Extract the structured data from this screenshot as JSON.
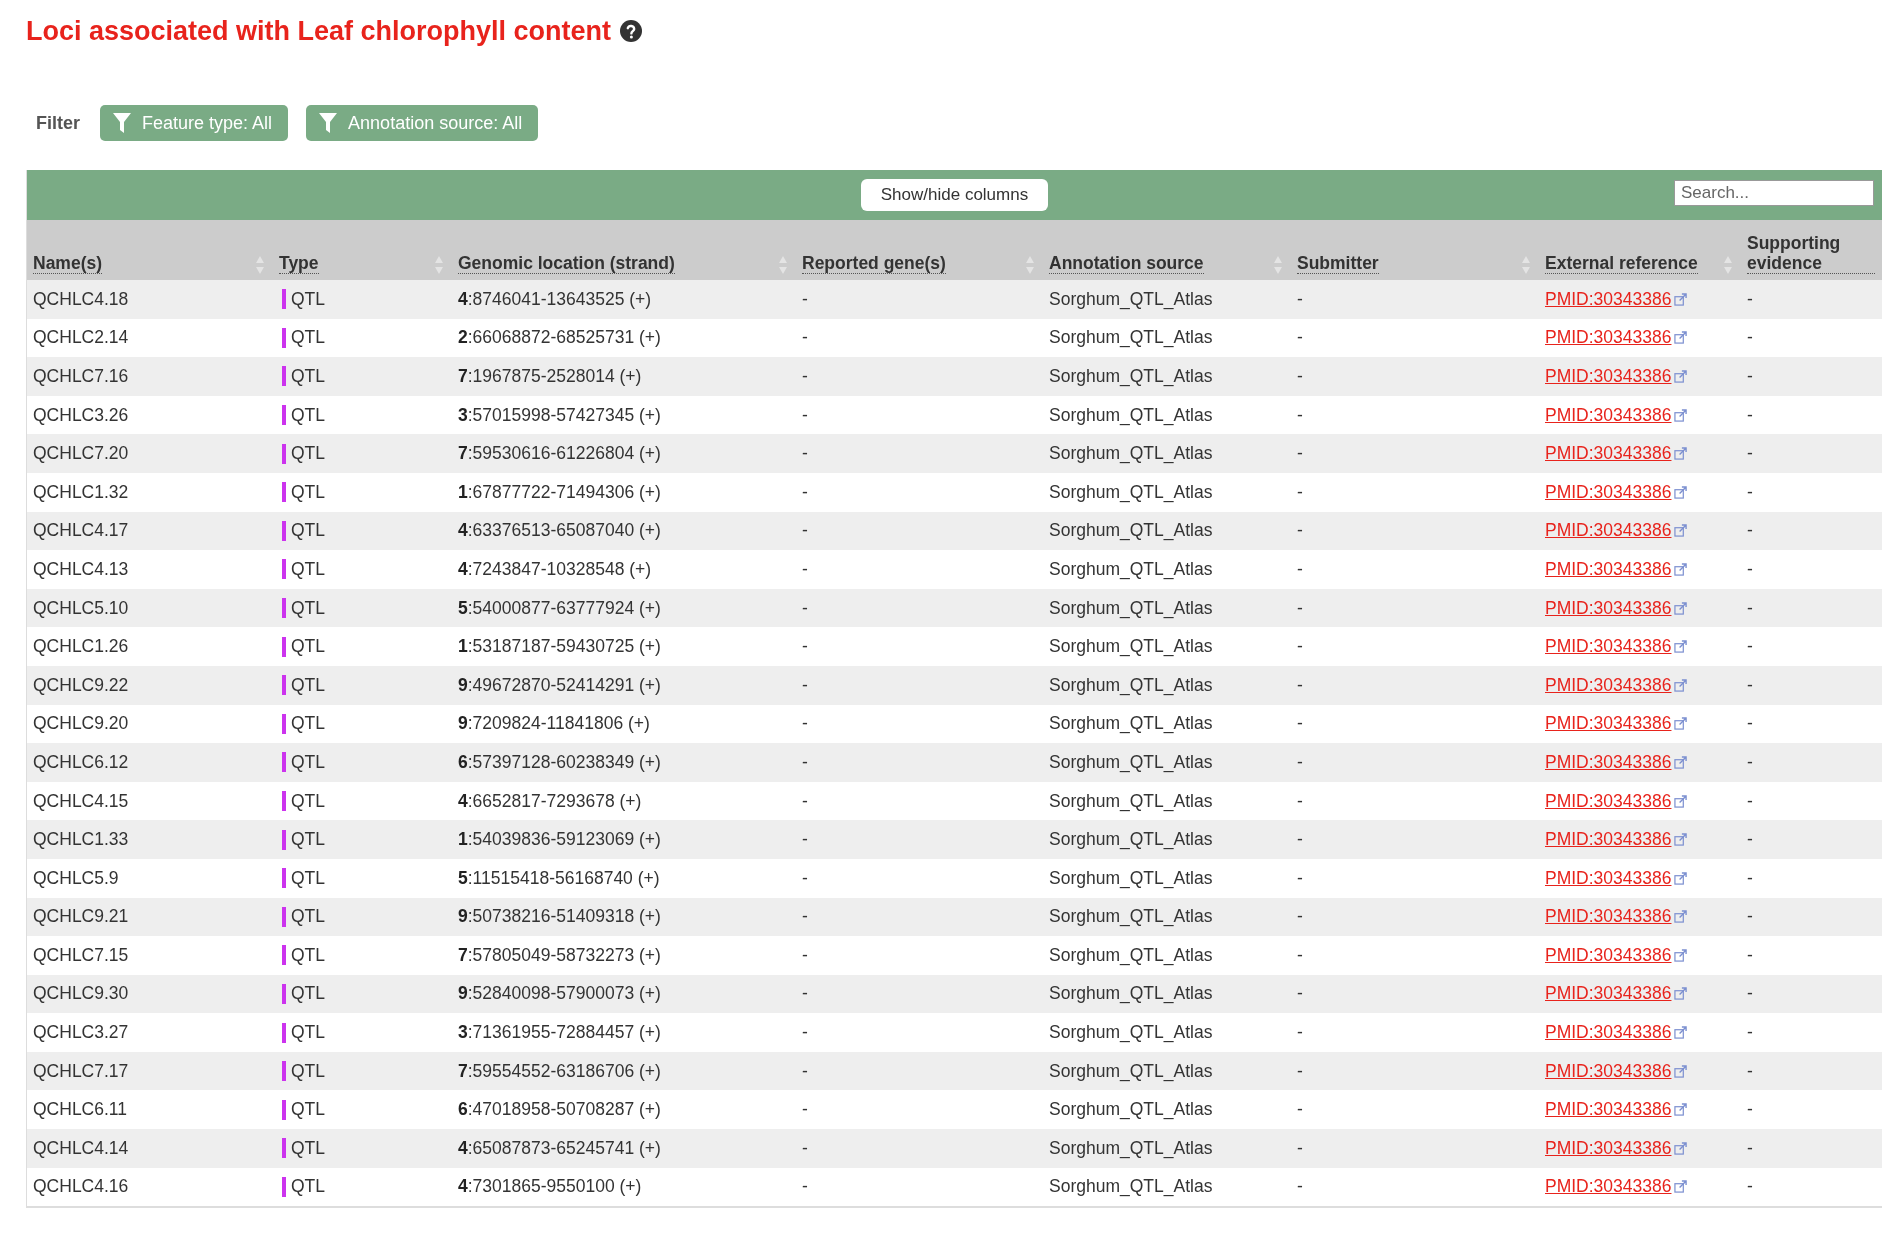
{
  "title": "Loci associated with Leaf chlorophyll content",
  "filter": {
    "label": "Filter",
    "buttons": [
      "Feature type: All",
      "Annotation source: All"
    ]
  },
  "toolbar": {
    "show_hide_button": "Show/hide columns",
    "search": {
      "placeholder": "Search..."
    }
  },
  "table": {
    "columns": [
      {
        "label": "Name(s)",
        "sortable": true
      },
      {
        "label": "Type",
        "sortable": true
      },
      {
        "label": "Genomic location (strand)",
        "sortable": true
      },
      {
        "label": "Reported gene(s)",
        "sortable": true
      },
      {
        "label": "Annotation source",
        "sortable": true
      },
      {
        "label": "Submitter",
        "sortable": true
      },
      {
        "label": "External reference",
        "sortable": true
      },
      {
        "label": "Supporting evidence",
        "sortable": false
      }
    ],
    "rows": [
      {
        "name": "QCHLC4.18",
        "type": "QTL",
        "color": "#cc33ee",
        "location": "**4**:8746041-13643525 (+)",
        "genes": "-",
        "source": "Sorghum_QTL_Atlas",
        "submitter": "-",
        "reference": "PMID:30343386",
        "evidence": "-"
      },
      {
        "name": "QCHLC2.14",
        "type": "QTL",
        "color": "#cc33ee",
        "location": "**2**:66068872-68525731 (+)",
        "genes": "-",
        "source": "Sorghum_QTL_Atlas",
        "submitter": "-",
        "reference": "PMID:30343386",
        "evidence": "-"
      },
      {
        "name": "QCHLC7.16",
        "type": "QTL",
        "color": "#cc33ee",
        "location": "**7**:1967875-2528014 (+)",
        "genes": "-",
        "source": "Sorghum_QTL_Atlas",
        "submitter": "-",
        "reference": "PMID:30343386",
        "evidence": "-"
      },
      {
        "name": "QCHLC3.26",
        "type": "QTL",
        "color": "#cc33ee",
        "location": "**3**:57015998-57427345 (+)",
        "genes": "-",
        "source": "Sorghum_QTL_Atlas",
        "submitter": "-",
        "reference": "PMID:30343386",
        "evidence": "-"
      },
      {
        "name": "QCHLC7.20",
        "type": "QTL",
        "color": "#cc33ee",
        "location": "**7**:59530616-61226804 (+)",
        "genes": "-",
        "source": "Sorghum_QTL_Atlas",
        "submitter": "-",
        "reference": "PMID:30343386",
        "evidence": "-"
      },
      {
        "name": "QCHLC1.32",
        "type": "QTL",
        "color": "#cc33ee",
        "location": "**1**:67877722-71494306 (+)",
        "genes": "-",
        "source": "Sorghum_QTL_Atlas",
        "submitter": "-",
        "reference": "PMID:30343386",
        "evidence": "-"
      },
      {
        "name": "QCHLC4.17",
        "type": "QTL",
        "color": "#cc33ee",
        "location": "**4**:63376513-65087040 (+)",
        "genes": "-",
        "source": "Sorghum_QTL_Atlas",
        "submitter": "-",
        "reference": "PMID:30343386",
        "evidence": "-"
      },
      {
        "name": "QCHLC4.13",
        "type": "QTL",
        "color": "#cc33ee",
        "location": "**4**:7243847-10328548 (+)",
        "genes": "-",
        "source": "Sorghum_QTL_Atlas",
        "submitter": "-",
        "reference": "PMID:30343386",
        "evidence": "-"
      },
      {
        "name": "QCHLC5.10",
        "type": "QTL",
        "color": "#cc33ee",
        "location": "**5**:54000877-63777924 (+)",
        "genes": "-",
        "source": "Sorghum_QTL_Atlas",
        "submitter": "-",
        "reference": "PMID:30343386",
        "evidence": "-"
      },
      {
        "name": "QCHLC1.26",
        "type": "QTL",
        "color": "#cc33ee",
        "location": "**1**:53187187-59430725 (+)",
        "genes": "-",
        "source": "Sorghum_QTL_Atlas",
        "submitter": "-",
        "reference": "PMID:30343386",
        "evidence": "-"
      },
      {
        "name": "QCHLC9.22",
        "type": "QTL",
        "color": "#cc33ee",
        "location": "**9**:49672870-52414291 (+)",
        "genes": "-",
        "source": "Sorghum_QTL_Atlas",
        "submitter": "-",
        "reference": "PMID:30343386",
        "evidence": "-"
      },
      {
        "name": "QCHLC9.20",
        "type": "QTL",
        "color": "#cc33ee",
        "location": "**9**:7209824-11841806 (+)",
        "genes": "-",
        "source": "Sorghum_QTL_Atlas",
        "submitter": "-",
        "reference": "PMID:30343386",
        "evidence": "-"
      },
      {
        "name": "QCHLC6.12",
        "type": "QTL",
        "color": "#cc33ee",
        "location": "**6**:57397128-60238349 (+)",
        "genes": "-",
        "source": "Sorghum_QTL_Atlas",
        "submitter": "-",
        "reference": "PMID:30343386",
        "evidence": "-"
      },
      {
        "name": "QCHLC4.15",
        "type": "QTL",
        "color": "#cc33ee",
        "location": "**4**:6652817-7293678 (+)",
        "genes": "-",
        "source": "Sorghum_QTL_Atlas",
        "submitter": "-",
        "reference": "PMID:30343386",
        "evidence": "-"
      },
      {
        "name": "QCHLC1.33",
        "type": "QTL",
        "color": "#cc33ee",
        "location": "**1**:54039836-59123069 (+)",
        "genes": "-",
        "source": "Sorghum_QTL_Atlas",
        "submitter": "-",
        "reference": "PMID:30343386",
        "evidence": "-"
      },
      {
        "name": "QCHLC5.9",
        "type": "QTL",
        "color": "#cc33ee",
        "location": "**5**:11515418-56168740 (+)",
        "genes": "-",
        "source": "Sorghum_QTL_Atlas",
        "submitter": "-",
        "reference": "PMID:30343386",
        "evidence": "-"
      },
      {
        "name": "QCHLC9.21",
        "type": "QTL",
        "color": "#cc33ee",
        "location": "**9**:50738216-51409318 (+)",
        "genes": "-",
        "source": "Sorghum_QTL_Atlas",
        "submitter": "-",
        "reference": "PMID:30343386",
        "evidence": "-"
      },
      {
        "name": "QCHLC7.15",
        "type": "QTL",
        "color": "#cc33ee",
        "location": "**7**:57805049-58732273 (+)",
        "genes": "-",
        "source": "Sorghum_QTL_Atlas",
        "submitter": "-",
        "reference": "PMID:30343386",
        "evidence": "-"
      },
      {
        "name": "QCHLC9.30",
        "type": "QTL",
        "color": "#cc33ee",
        "location": "**9**:52840098-57900073 (+)",
        "genes": "-",
        "source": "Sorghum_QTL_Atlas",
        "submitter": "-",
        "reference": "PMID:30343386",
        "evidence": "-"
      },
      {
        "name": "QCHLC3.27",
        "type": "QTL",
        "color": "#cc33ee",
        "location": "**3**:71361955-72884457 (+)",
        "genes": "-",
        "source": "Sorghum_QTL_Atlas",
        "submitter": "-",
        "reference": "PMID:30343386",
        "evidence": "-"
      },
      {
        "name": "QCHLC7.17",
        "type": "QTL",
        "color": "#cc33ee",
        "location": "**7**:59554552-63186706 (+)",
        "genes": "-",
        "source": "Sorghum_QTL_Atlas",
        "submitter": "-",
        "reference": "PMID:30343386",
        "evidence": "-"
      },
      {
        "name": "QCHLC6.11",
        "type": "QTL",
        "color": "#cc33ee",
        "location": "**6**:47018958-50708287 (+)",
        "genes": "-",
        "source": "Sorghum_QTL_Atlas",
        "submitter": "-",
        "reference": "PMID:30343386",
        "evidence": "-"
      },
      {
        "name": "QCHLC4.14",
        "type": "QTL",
        "color": "#cc33ee",
        "location": "**4**:65087873-65245741 (+)",
        "genes": "-",
        "source": "Sorghum_QTL_Atlas",
        "submitter": "-",
        "reference": "PMID:30343386",
        "evidence": "-"
      },
      {
        "name": "QCHLC4.16",
        "type": "QTL",
        "color": "#cc33ee",
        "location": "**4**:7301865-9550100 (+)",
        "genes": "-",
        "source": "Sorghum_QTL_Atlas",
        "submitter": "-",
        "reference": "PMID:30343386",
        "evidence": "-"
      }
    ]
  }
}
